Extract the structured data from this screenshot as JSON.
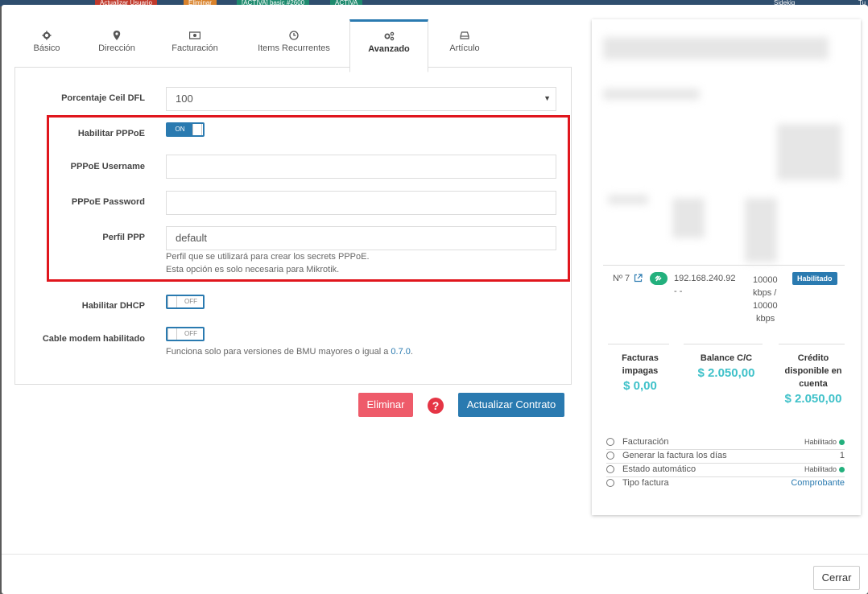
{
  "background": {
    "chips": [
      "Actualizar Usuario",
      "Eliminar",
      "[ACTIVA] basic #2600",
      "ACTIVA",
      "Sidekiq",
      "Tu"
    ]
  },
  "tabs": [
    {
      "label": "Básico",
      "icon": "gear-icon"
    },
    {
      "label": "Dirección",
      "icon": "map-marker-icon"
    },
    {
      "label": "Facturación",
      "icon": "money-icon"
    },
    {
      "label": "Items Recurrentes",
      "icon": "clock-icon"
    },
    {
      "label": "Avanzado",
      "icon": "gears-icon"
    },
    {
      "label": "Artículo",
      "icon": "inbox-icon"
    }
  ],
  "form": {
    "ceil_label": "Porcentaje Ceil DFL",
    "ceil_value": "100",
    "pppoe_label": "Habilitar PPPoE",
    "pppoe_state": "ON",
    "username_label": "PPPoE Username",
    "username_value": "",
    "password_label": "PPPoE Password",
    "password_value": "",
    "profile_label": "Perfil PPP",
    "profile_value": "default",
    "profile_help_1": "Perfil que se utilizará para crear los secrets PPPoE.",
    "profile_help_2": "Esta opción es solo necesaria para Mikrotik.",
    "dhcp_label": "Habilitar DHCP",
    "dhcp_state": "OFF",
    "cablemodem_label": "Cable modem habilitado",
    "cablemodem_state": "OFF",
    "cablemodem_help": "Funciona solo para versiones de BMU mayores o igual a ",
    "cablemodem_help_link": "0.7.0",
    "cablemodem_help_end": "."
  },
  "actions": {
    "delete_label": "Eliminar",
    "help_glyph": "?",
    "update_label": "Actualizar Contrato",
    "close_label": "Cerrar"
  },
  "card": {
    "connection": {
      "number": "Nº 7",
      "ip": "192.168.240.92",
      "ip_suffix": "- -",
      "speed_1": "10000",
      "speed_2": "kbps /",
      "speed_3": "10000",
      "speed_4": "kbps",
      "status": "Habilitado"
    },
    "summary": [
      {
        "title_1": "Facturas",
        "title_2": "impagas",
        "title_3": "",
        "value": "$ 0,00"
      },
      {
        "title_1": "Balance C/C",
        "title_2": "",
        "title_3": "",
        "value": "$ 2.050,00"
      },
      {
        "title_1": "Crédito",
        "title_2": "disponible en",
        "title_3": "cuenta",
        "value": "$ 2.050,00"
      }
    ],
    "options": [
      {
        "label": "Facturación",
        "value": "Habilitado"
      },
      {
        "label": "Generar la factura los días",
        "value": "1"
      },
      {
        "label": "Estado automático",
        "value": "Habilitado"
      },
      {
        "label": "Tipo factura",
        "value": "Comprobante"
      }
    ]
  },
  "colors": {
    "primary": "#2a7ab0",
    "danger": "#ee5b6a",
    "highlight": "#e0161d",
    "money": "#3fc1c9",
    "enabled_dot": "#23b07d"
  }
}
